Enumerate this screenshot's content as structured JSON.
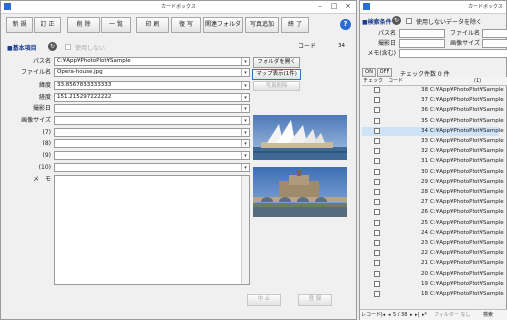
{
  "main_window": {
    "title": "カードボックス",
    "toolbar": [
      "新 規",
      "訂 正",
      "削 除",
      "一 覧",
      "印 刷",
      "復 写",
      "関連フォルダ",
      "写真追加",
      "終 了"
    ],
    "help_icon": "?",
    "section_title": "■基本項目",
    "unused_label": "使用しない",
    "code_label": "コード",
    "code_value": "34",
    "fields": {
      "path_label": "パス名",
      "path_value": "C:¥App¥PhotoPlot¥Sample",
      "file_label": "ファイル名",
      "file_value": "Opera-house.jpg",
      "lat_label": "緯度",
      "lat_value": "33.8567833333333",
      "lon_label": "経度",
      "lon_value": "151.215297222222",
      "date_label": "撮影日",
      "size_label": "画像サイズ",
      "f7": "(7)",
      "f8": "(8)",
      "f9": "(9)",
      "f10": "(10)",
      "memo_label": "メ　モ"
    },
    "open_folder_button": "フォルダを開く",
    "map_button": "マップ表示(1件)",
    "photo_delete_button": "写真削除",
    "cancel_button": "中 止",
    "register_button": "登 録"
  },
  "search_window": {
    "title": "カードボックス",
    "section_title": "■検索条件",
    "unused_data_label": "使用しないデータを除く",
    "path_label": "パス名",
    "file_label": "ファイル名",
    "date_label": "撮影日",
    "size_label": "画像サイズ",
    "memo_label": "メモ(含む)",
    "on_label": "ON",
    "off_label": "OFF",
    "check_count": "チェック件数 0 件",
    "col_check": "チェック",
    "col_code": "コード",
    "col_1": "(1)",
    "rows": [
      {
        "code": "38",
        "path": "C:¥App¥PhotoPlot¥Sample"
      },
      {
        "code": "37",
        "path": "C:¥App¥PhotoPlot¥Sample"
      },
      {
        "code": "36",
        "path": "C:¥App¥PhotoPlot¥Sample"
      },
      {
        "code": "35",
        "path": "C:¥App¥PhotoPlot¥Sample"
      },
      {
        "code": "34",
        "path": "C:¥App¥PhotoPlot¥Sample"
      },
      {
        "code": "33",
        "path": "C:¥App¥PhotoPlot¥Sample"
      },
      {
        "code": "32",
        "path": "C:¥App¥PhotoPlot¥Sample"
      },
      {
        "code": "31",
        "path": "C:¥App¥PhotoPlot¥Sample"
      },
      {
        "code": "30",
        "path": "C:¥App¥PhotoPlot¥Sample"
      },
      {
        "code": "29",
        "path": "C:¥App¥PhotoPlot¥Sample"
      },
      {
        "code": "28",
        "path": "C:¥App¥PhotoPlot¥Sample"
      },
      {
        "code": "27",
        "path": "C:¥App¥PhotoPlot¥Sample"
      },
      {
        "code": "26",
        "path": "C:¥App¥PhotoPlot¥Sample"
      },
      {
        "code": "25",
        "path": "C:¥App¥PhotoPlot¥Sample"
      },
      {
        "code": "24",
        "path": "C:¥App¥PhotoPlot¥Sample"
      },
      {
        "code": "23",
        "path": "C:¥App¥PhotoPlot¥Sample"
      },
      {
        "code": "22",
        "path": "C:¥App¥PhotoPlot¥Sample"
      },
      {
        "code": "21",
        "path": "C:¥App¥PhotoPlot¥Sample"
      },
      {
        "code": "20",
        "path": "C:¥App¥PhotoPlot¥Sample"
      },
      {
        "code": "19",
        "path": "C:¥App¥PhotoPlot¥Sample"
      },
      {
        "code": "18",
        "path": "C:¥App¥PhotoPlot¥Sample"
      }
    ],
    "selected_code": "34",
    "record_nav": {
      "label": "レコード:",
      "position": "5 / 38",
      "filter": "フィルター なし",
      "search": "検索"
    }
  },
  "colors": {
    "accent": "#1a3d8c",
    "selected_row": "#cfe3f7",
    "title_icon": "#2a6bd6"
  }
}
